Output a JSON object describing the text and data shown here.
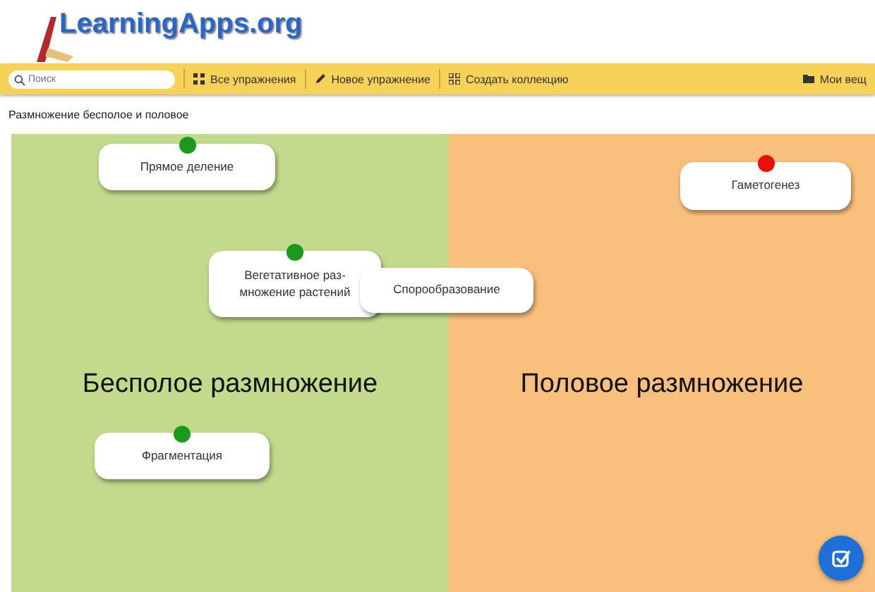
{
  "logo": {
    "text": "LearningApps.org"
  },
  "toolbar": {
    "search": {
      "placeholder": "Поиск"
    },
    "items": [
      "Все упражнения",
      "Новое упражнение",
      "Создать коллекцию"
    ],
    "right_item": "Мои вещ"
  },
  "exercise": {
    "title": "Размножение бесполое и половое"
  },
  "categories": [
    {
      "label": "Бесполое размножение",
      "color": "#c3da8c"
    },
    {
      "label": "Половое размножение",
      "color": "#f9bf7d"
    }
  ],
  "cards": [
    {
      "text": "Прямое деление",
      "color": "#1a9a1a"
    },
    {
      "text": "Вегетативное раз-\nмножение растений",
      "color": "#1a9a1a"
    },
    {
      "text": "Спорообразование"
    },
    {
      "text": "Гаметогенез",
      "color": "#e8120c"
    },
    {
      "text": "Фрагментация",
      "color": "#1a9a1a"
    }
  ]
}
